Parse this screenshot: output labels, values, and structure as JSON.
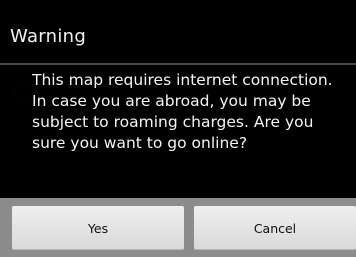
{
  "dialog": {
    "title": "Warning",
    "message": "This map requires internet connection. In case you are abroad, you may be subject to roaming charges. Are you sure you want to go online?",
    "buttons": {
      "yes": "Yes",
      "cancel": "Cancel"
    }
  },
  "colors": {
    "button_bar": "#8c8c8c",
    "button_face": "#e6e6e6",
    "dialog_background": "#000000",
    "text": "#f4f4f4"
  }
}
